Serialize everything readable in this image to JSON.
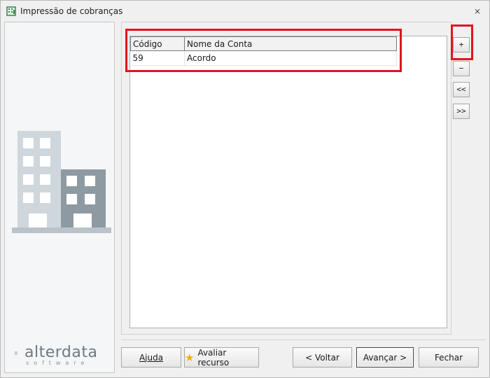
{
  "window": {
    "title": "Impressão de cobranças",
    "icon": "building-grid-icon",
    "close_icon": "close-icon"
  },
  "brand": {
    "name": "alterdata",
    "sub": "software"
  },
  "grid": {
    "columns": [
      "Código",
      "Nome da Conta"
    ],
    "rows": [
      {
        "codigo": "59",
        "nome": "Acordo"
      }
    ]
  },
  "side_buttons": {
    "add": "+",
    "remove": "−",
    "first": "<<",
    "last": ">>"
  },
  "footer": {
    "ajuda": "Ajuda",
    "avaliar": "Avaliar recurso",
    "voltar": "< Voltar",
    "avancar": "Avançar >",
    "fechar": "Fechar"
  },
  "colors": {
    "highlight": "#e0151f",
    "building_light": "#cfd7dc",
    "building_dark": "#8e9aa2"
  }
}
